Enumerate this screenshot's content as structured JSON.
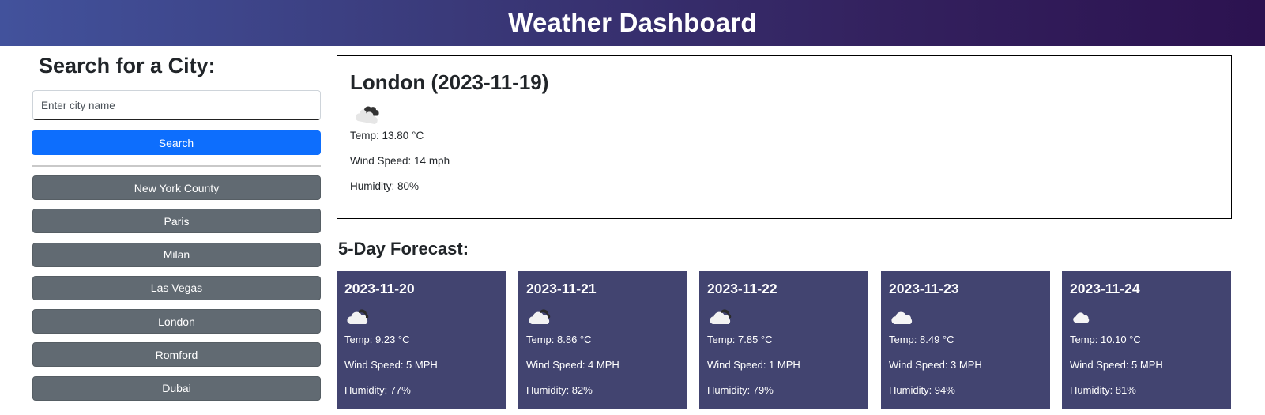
{
  "header": {
    "title": "Weather Dashboard"
  },
  "sidebar": {
    "title": "Search for a City:",
    "input_placeholder": "Enter city name",
    "input_value": "",
    "search_label": "Search",
    "history": [
      "New York County",
      "Paris",
      "Milan",
      "Las Vegas",
      "London",
      "Romford",
      "Dubai"
    ]
  },
  "current": {
    "title": "London (2023-11-19)",
    "icon": "broken-clouds-icon",
    "temp": "Temp: 13.80 °C",
    "wind": "Wind Speed: 14 mph",
    "humidity": "Humidity: 80%"
  },
  "forecast": {
    "title": "5-Day Forecast:",
    "days": [
      {
        "date": "2023-11-20",
        "icon": "cloud-icon",
        "temp": "Temp: 9.23 °C",
        "wind": "Wind Speed: 5 MPH",
        "humidity": "Humidity: 77%"
      },
      {
        "date": "2023-11-21",
        "icon": "cloud-icon",
        "temp": "Temp: 8.86 °C",
        "wind": "Wind Speed: 4 MPH",
        "humidity": "Humidity: 82%"
      },
      {
        "date": "2023-11-22",
        "icon": "cloud-icon",
        "temp": "Temp: 7.85 °C",
        "wind": "Wind Speed: 1 MPH",
        "humidity": "Humidity: 79%"
      },
      {
        "date": "2023-11-23",
        "icon": "cloud-icon",
        "temp": "Temp: 8.49 °C",
        "wind": "Wind Speed: 3 MPH",
        "humidity": "Humidity: 94%"
      },
      {
        "date": "2023-11-24",
        "icon": "cloud-icon",
        "temp": "Temp: 10.10 °C",
        "wind": "Wind Speed: 5 MPH",
        "humidity": "Humidity: 81%"
      }
    ]
  },
  "colors": {
    "primary_button": "#0d6efd",
    "history_button": "#616a72",
    "forecast_card": "#424470",
    "header_gradient_start": "#42529c",
    "header_gradient_end": "#2c1250"
  }
}
